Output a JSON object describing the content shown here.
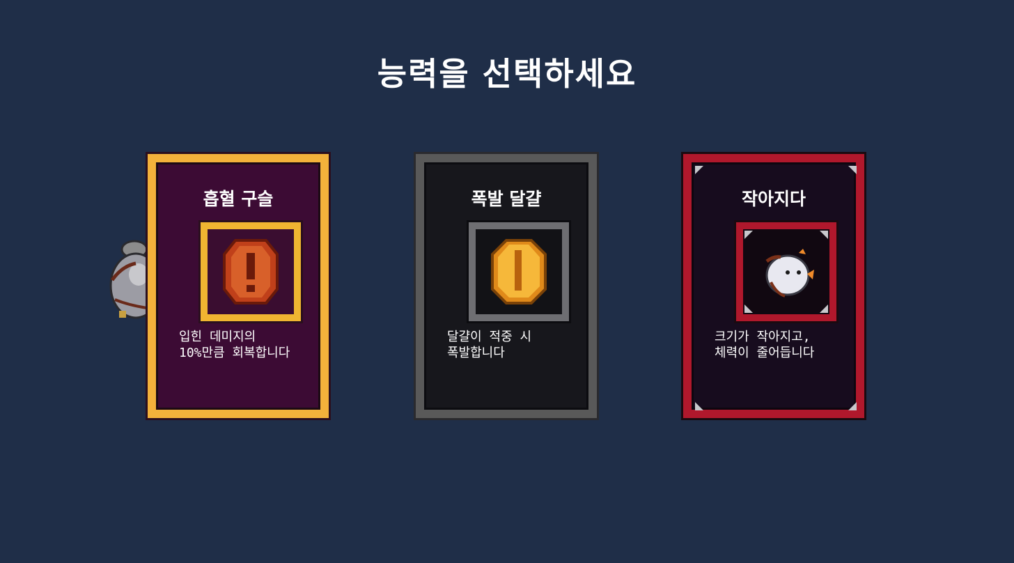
{
  "title": "능력을 선택하세요",
  "cards": [
    {
      "name": "흡혈 구슬",
      "description": "입힌 데미지의\n10%만큼 회복합니다",
      "rarity_color": "#f3b23b",
      "icon": "red-exclamation-gem-icon"
    },
    {
      "name": "폭발 달걀",
      "description": "달걀이 적중 시\n폭발합니다",
      "rarity_color": "#595959",
      "icon": "gold-coin-egg-icon"
    },
    {
      "name": "작아지다",
      "description": "크기가 작아지고,\n체력이 줄어듭니다",
      "rarity_color": "#b0182c",
      "icon": "shrink-chicken-icon"
    }
  ],
  "colors": {
    "background": "#1f2e48",
    "gold": "#f3b23b",
    "gray": "#595959",
    "red": "#b0182c"
  }
}
